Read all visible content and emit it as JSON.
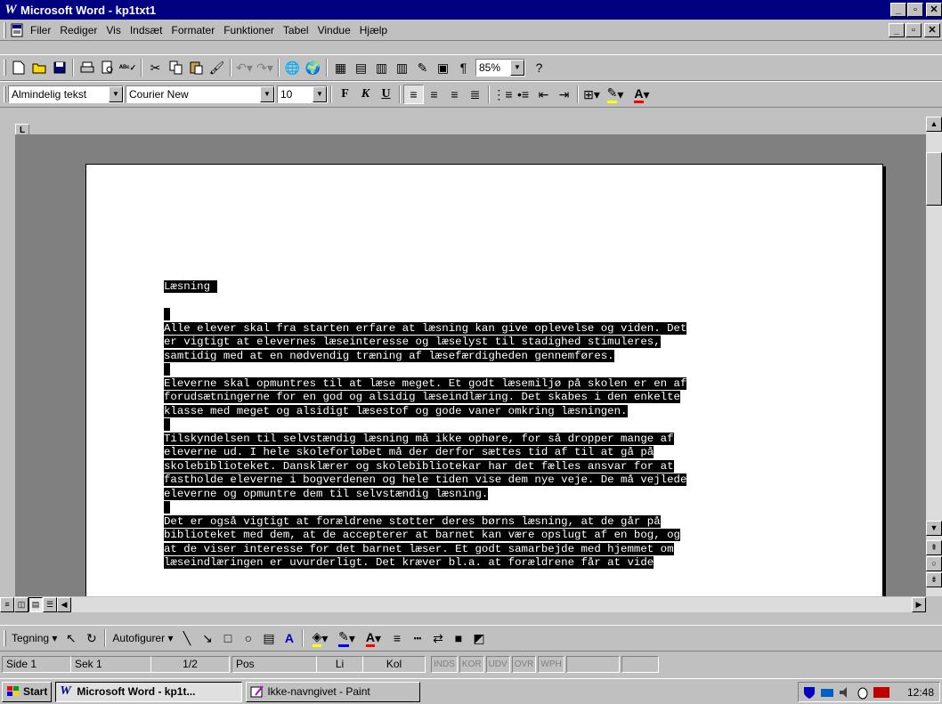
{
  "window": {
    "title": "Microsoft Word - kp1txt1",
    "app_icon": "W"
  },
  "menubar": {
    "items": [
      "Filer",
      "Rediger",
      "Vis",
      "Indsæt",
      "Formater",
      "Funktioner",
      "Tabel",
      "Vindue",
      "Hjælp"
    ]
  },
  "toolbar_standard": {
    "zoom": "85%"
  },
  "toolbar_format": {
    "style": "Almindelig tekst",
    "font": "Courier New",
    "size": "10",
    "bold_label": "F",
    "italic_label": "K",
    "underline_label": "U"
  },
  "ruler": {
    "tab_selector": "L"
  },
  "document": {
    "lines": [
      "Læsning ",
      "",
      " ",
      "Alle elever skal fra starten erfare at læsning kan give oplevelse og viden. Det",
      "er vigtigt at elevernes læseinteresse og læselyst til stadighed stimuleres,",
      "samtidig med at en nødvendig træning af læsefærdigheden gennemføres.",
      " ",
      "Eleverne skal opmuntres til at læse meget. Et godt læsemiljø på skolen er en af",
      "forudsætningerne for en god og alsidig læseindlæring. Det skabes i den enkelte",
      "klasse med meget og alsidigt læsestof og gode vaner omkring læsningen.",
      " ",
      "Tilskyndelsen til selvstændig læsning må ikke ophøre, for så dropper mange af",
      "eleverne ud. I hele skoleforløbet må der derfor sættes tid af til at gå på",
      "skolebiblioteket. Dansklærer og skolebibliotekar har det fælles ansvar for at",
      "fastholde eleverne i bogverdenen og hele tiden vise dem nye veje. De må vejlede",
      "eleverne og opmuntre dem til selvstændig læsning.",
      " ",
      "Det er også vigtigt at forældrene støtter deres børns læsning, at de går på",
      "biblioteket med dem, at de accepterer at barnet kan være opslugt af en bog, og",
      "at de viser interesse for det barnet læser. Et godt samarbejde med hjemmet om",
      "læseindlæringen er uvurderligt. Det kræver bl.a. at forældrene får at vide"
    ]
  },
  "drawing_toolbar": {
    "draw_label": "Tegning",
    "autoshapes_label": "Autofigurer"
  },
  "statusbar": {
    "page": "Side 1",
    "section": "Sek 1",
    "pages": "1/2",
    "pos": "Pos",
    "line": "Li",
    "col": "Kol",
    "indicators": [
      "INDS",
      "KOR",
      "UDV",
      "OVR",
      "WPH"
    ]
  },
  "taskbar": {
    "start_label": "Start",
    "tasks": [
      "Microsoft Word - kp1t...",
      "Ikke-navngivet - Paint"
    ],
    "clock": "12:48"
  },
  "colors": {
    "titlebar": "#000080",
    "selection": "#000000",
    "workspace": "#808080"
  }
}
